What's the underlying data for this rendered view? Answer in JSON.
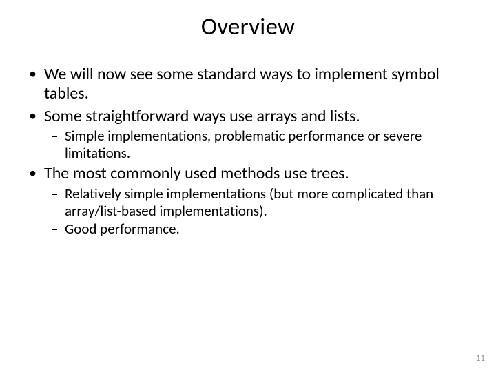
{
  "slide": {
    "title": "Overview",
    "bullets": {
      "b1": "We will now see some standard ways to implement symbol tables.",
      "b2": "Some straightforward ways use arrays and lists.",
      "b2_sub1": "Simple implementations, problematic performance or severe limitations.",
      "b3": "The most commonly used methods use trees.",
      "b3_sub1": "Relatively simple implementations (but more complicated than array/list-based implementations).",
      "b3_sub2": "Good performance."
    },
    "page_number": "11"
  }
}
